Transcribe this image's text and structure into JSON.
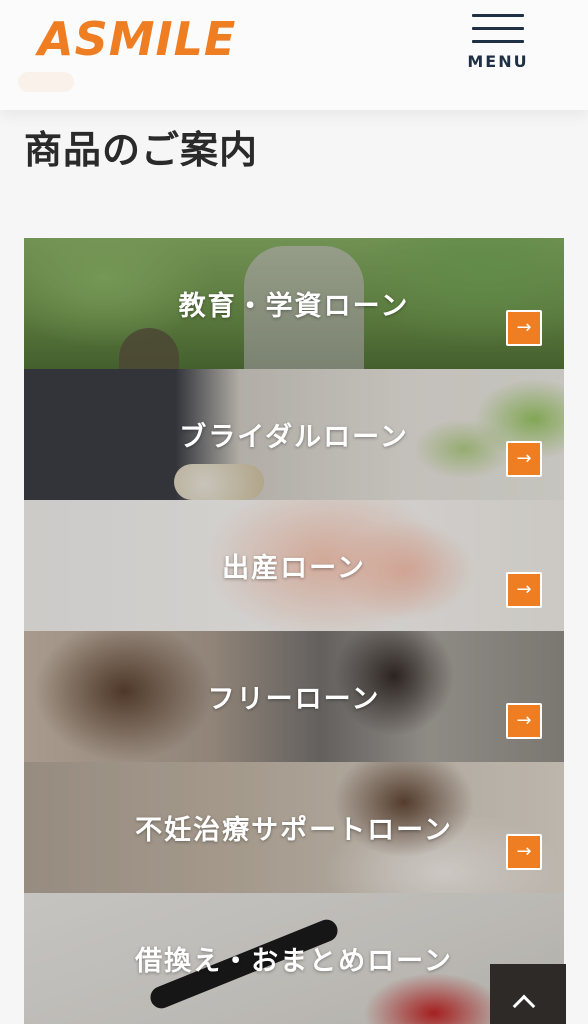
{
  "header": {
    "logo_text": "ASMILE",
    "menu_label": "MENU"
  },
  "page": {
    "title": "商品のご案内"
  },
  "products": [
    {
      "label": "教育・学資ローン",
      "arrow": "→"
    },
    {
      "label": "ブライダルローン",
      "arrow": "→"
    },
    {
      "label": "出産ローン",
      "arrow": "→"
    },
    {
      "label": "フリーローン",
      "arrow": "→"
    },
    {
      "label": "不妊治療サポートローン",
      "arrow": "→"
    },
    {
      "label": "借換え・おまとめローン",
      "arrow": "→"
    }
  ],
  "colors": {
    "accent": "#ef7d22",
    "navy": "#1f3044",
    "title_text": "#2a2a2a",
    "background": "#f6f6f6"
  },
  "icons": {
    "menu": "hamburger-icon",
    "card_arrow": "arrow-right-icon",
    "back_to_top": "chevron-up-icon"
  }
}
